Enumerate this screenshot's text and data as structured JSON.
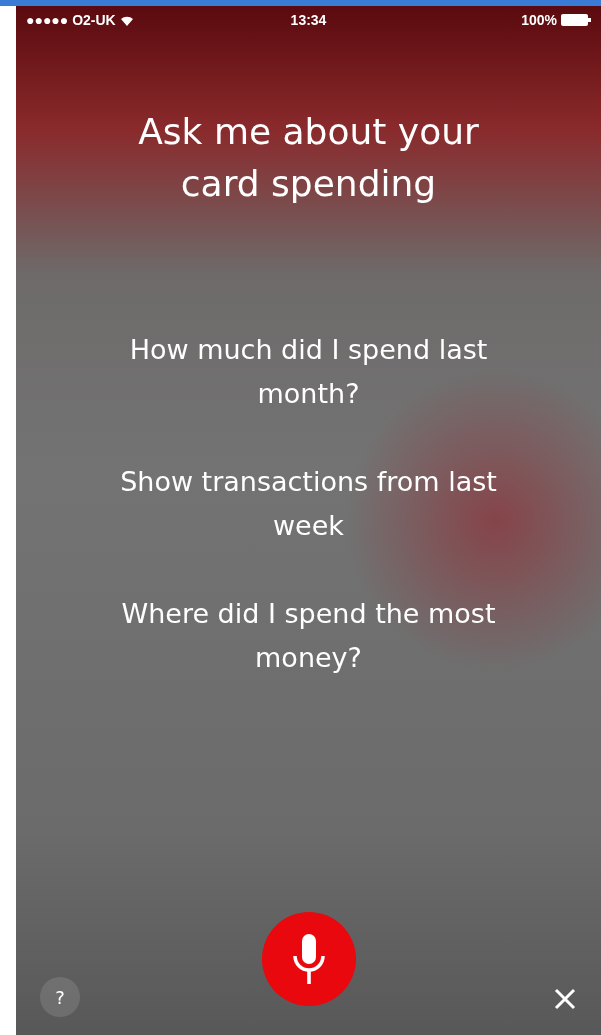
{
  "status_bar": {
    "signal": "●●●●● O2-UK",
    "time": "13:34",
    "battery": "100%"
  },
  "title": "Ask me about your card spending",
  "suggestions": [
    "How much did I spend last month?",
    "Show transactions from last week",
    "Where did I spend the most money?"
  ],
  "help_button": {
    "label": "?"
  }
}
